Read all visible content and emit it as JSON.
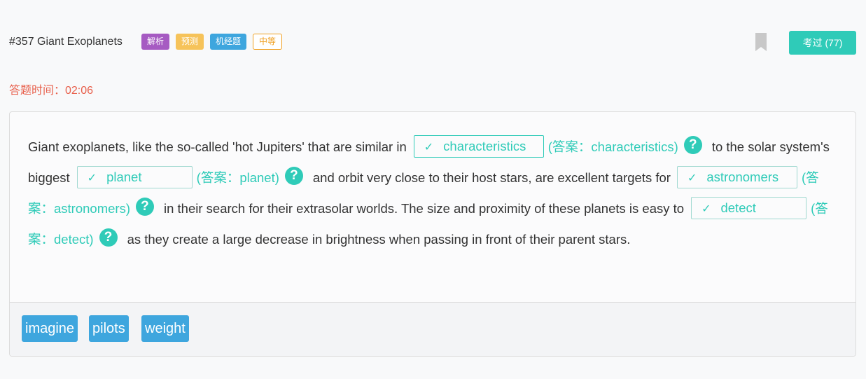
{
  "header": {
    "title": "#357 Giant Exoplanets",
    "tags": [
      "解析",
      "预测",
      "机经题",
      "中等"
    ],
    "pass_button": "考过 (77)"
  },
  "timer": "答题时间：02:06",
  "passage": {
    "seg0": "Giant exoplanets, like the so-called 'hot Jupiters' that are similar in",
    "blank0": "characteristics",
    "ans0": "(答案：characteristics)",
    "seg1": "to the solar system's biggest",
    "blank1": "planet",
    "ans1": "(答案：planet)",
    "seg2": "and orbit very close to their host stars, are excellent targets for",
    "blank2": "astronomers",
    "ans2": "(答案：astronomers)",
    "seg3": "in their search for their extrasolar worlds. The size and proximity of these planets is easy to",
    "blank3": "detect",
    "ans3": "(答案：detect)",
    "seg4": "as they create a large decrease in brightness when passing in front of their parent stars.",
    "check": "✓",
    "help": "?"
  },
  "word_bank": [
    "imagine",
    "pilots",
    "weight"
  ],
  "colors": {
    "accent": "#2fcbb8",
    "timer": "#e8604c",
    "chip": "#3ea6de"
  },
  "icons": [
    "bookmark-icon",
    "check-icon",
    "help-icon"
  ]
}
